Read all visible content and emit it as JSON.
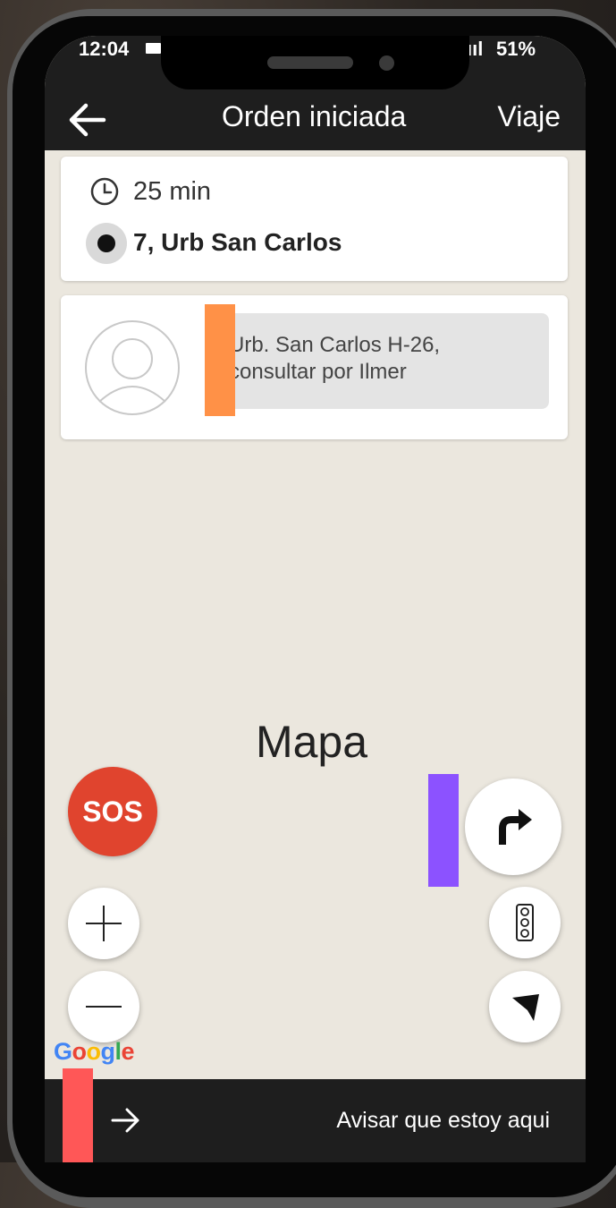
{
  "status_bar": {
    "time": "12:04",
    "signal": "ııl",
    "battery": "51%"
  },
  "header": {
    "back_icon": "arrow-left-icon",
    "title": "Orden iniciada",
    "action_label": "Viaje"
  },
  "trip_info": {
    "clock_icon": "clock-icon",
    "eta": "25 min",
    "destination": "7, Urb San Carlos"
  },
  "passenger_note": {
    "avatar_icon": "user-avatar-icon",
    "note": "Urb. San Carlos H-26, consultar por Ilmer"
  },
  "map": {
    "label": "Mapa",
    "attribution": [
      "G",
      "o",
      "o",
      "g",
      "l",
      "e"
    ]
  },
  "controls": {
    "sos_label": "SOS",
    "zoom_in_icon": "plus-icon",
    "zoom_out_icon": "minus-icon",
    "navigation_icon": "turn-right-icon",
    "traffic_icon": "traffic-light-icon",
    "locate_icon": "navigation-arrow-icon"
  },
  "bottom_bar": {
    "arrow_icon": "arrow-right-icon",
    "action_label": "Avisar que estoy aqui"
  },
  "colors": {
    "header_bg": "#1e1e1e",
    "map_bg": "#ebe7de",
    "sos_red": "#e0442e",
    "marker_orange": "#ff9147",
    "marker_purple": "#8c52ff",
    "marker_red": "#ff5757"
  }
}
